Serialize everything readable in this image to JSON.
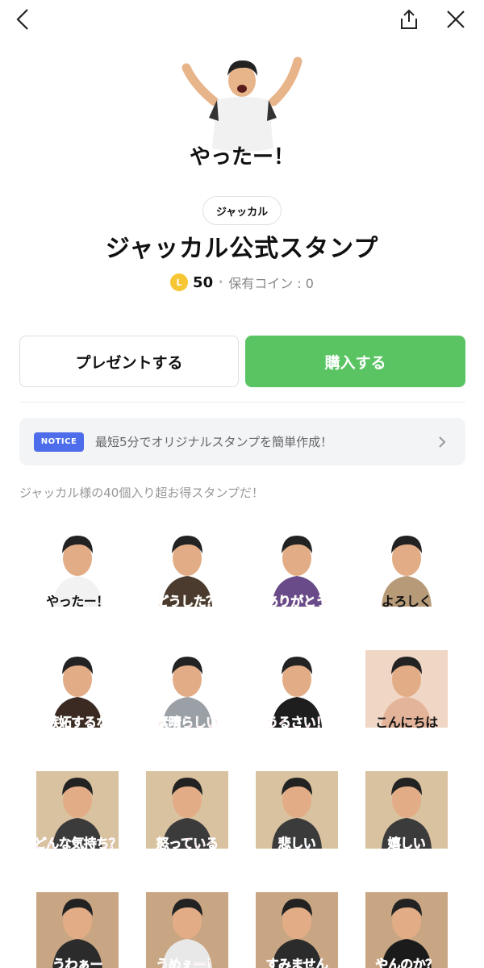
{
  "header": {
    "back_icon": "chevron-left-icon",
    "share_icon": "share-icon",
    "close_icon": "close-icon"
  },
  "product": {
    "hero_caption": "やったー！",
    "author": "ジャッカル",
    "title": "ジャッカル公式スタンプ",
    "coin_symbol": "L",
    "price": "50",
    "owned_coins": "保有コイン : 0"
  },
  "actions": {
    "gift_label": "プレゼントする",
    "buy_label": "購入する"
  },
  "notice": {
    "badge": "NOTICE",
    "text": "最短5分でオリジナルスタンプを簡単作成！"
  },
  "description": "ジャッカル様の40個入り超お得スタンプだ！",
  "stickers": [
    {
      "caption": "やったー！",
      "color": "#111111"
    },
    {
      "caption": "どうした？",
      "color": "#f07a2a"
    },
    {
      "caption": "ありがとう",
      "color": "#f07a2a"
    },
    {
      "caption": "よろしく",
      "color": "#111111"
    },
    {
      "caption": "嫉妬するな",
      "color": "#e53935"
    },
    {
      "caption": "素晴らしい",
      "color": "#e53935"
    },
    {
      "caption": "うるさい！",
      "color": "#e53935"
    },
    {
      "caption": "こんにちは",
      "color": "#111111"
    },
    {
      "caption": "どんな気持ち？",
      "color": "#c14fe0"
    },
    {
      "caption": "怒っている",
      "color": "#e53935"
    },
    {
      "caption": "悲しい",
      "color": "#4da3ef"
    },
    {
      "caption": "嬉しい",
      "color": "#f28bb8"
    },
    {
      "caption": "うわぁー",
      "color": "#7a4de0"
    },
    {
      "caption": "うめぇー！",
      "color": "#e53935"
    },
    {
      "caption": "すみません",
      "color": "#4da3ef"
    },
    {
      "caption": "やんのか？",
      "color": "#f07a2a"
    }
  ]
}
